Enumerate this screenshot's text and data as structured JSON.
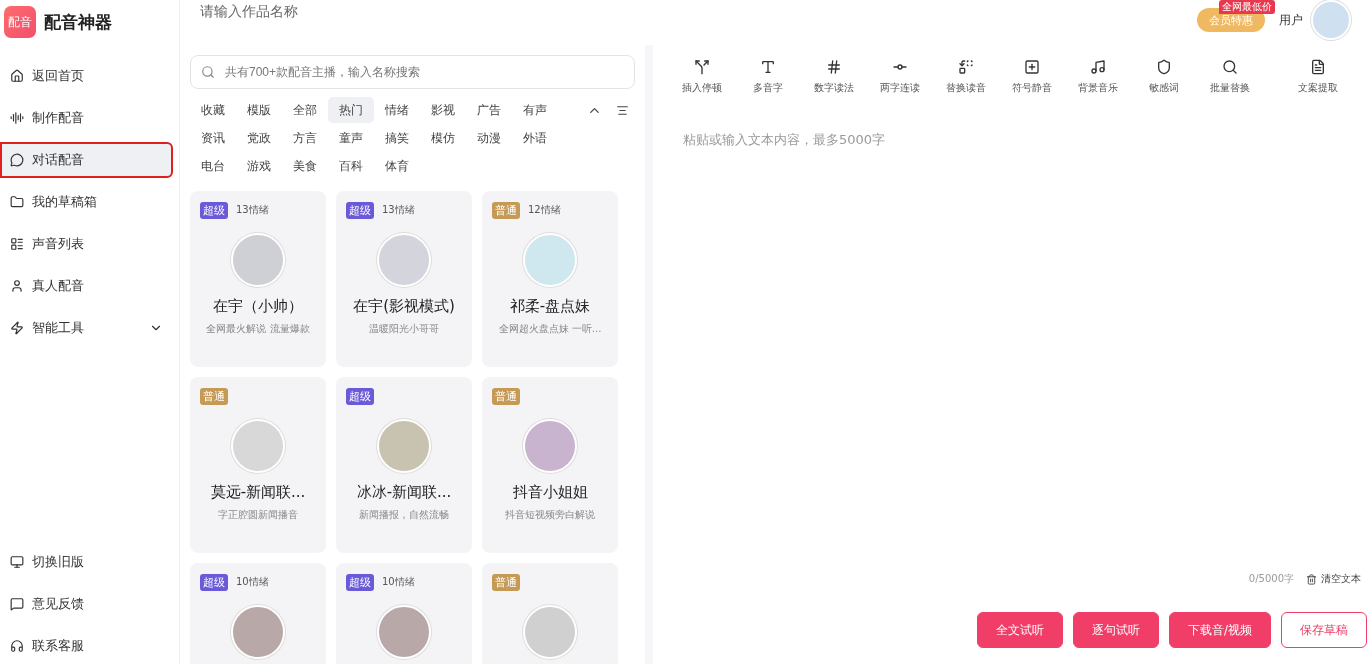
{
  "app": {
    "logo_text": "配音",
    "title": "配音神器"
  },
  "sidebar": {
    "items": [
      {
        "label": "返回首页",
        "selected": false
      },
      {
        "label": "制作配音",
        "selected": false
      },
      {
        "label": "对话配音",
        "selected": true
      },
      {
        "label": "我的草稿箱",
        "selected": false
      },
      {
        "label": "声音列表",
        "selected": false
      },
      {
        "label": "真人配音",
        "selected": false
      },
      {
        "label": "智能工具",
        "selected": false,
        "expanded": false
      }
    ],
    "bottom_items": [
      {
        "label": "切换旧版"
      },
      {
        "label": "意见反馈"
      },
      {
        "label": "联系客服"
      }
    ]
  },
  "header": {
    "title_placeholder": "请输入作品名称",
    "promo_button": "会员特惠",
    "promo_badge": "全网最低价",
    "user_name": "用户"
  },
  "voices": {
    "search_placeholder": "共有700+款配音主播，输入名称搜索",
    "categories": [
      {
        "label": "收藏",
        "selected": false
      },
      {
        "label": "模版",
        "selected": false
      },
      {
        "label": "全部",
        "selected": false
      },
      {
        "label": "热门",
        "selected": true
      },
      {
        "label": "情绪",
        "selected": false
      },
      {
        "label": "影视",
        "selected": false
      },
      {
        "label": "广告",
        "selected": false
      },
      {
        "label": "有声",
        "selected": false
      },
      {
        "label": "资讯",
        "selected": false
      },
      {
        "label": "党政",
        "selected": false
      },
      {
        "label": "方言",
        "selected": false
      },
      {
        "label": "童声",
        "selected": false
      },
      {
        "label": "搞笑",
        "selected": false
      },
      {
        "label": "模仿",
        "selected": false
      },
      {
        "label": "动漫",
        "selected": false
      },
      {
        "label": "外语",
        "selected": false
      },
      {
        "label": "电台",
        "selected": false
      },
      {
        "label": "游戏",
        "selected": false
      },
      {
        "label": "美食",
        "selected": false
      },
      {
        "label": "百科",
        "selected": false
      },
      {
        "label": "体育",
        "selected": false
      }
    ],
    "cards": [
      {
        "tier": "超级",
        "kind": "super",
        "emotions": "13情绪",
        "name": "在宇（小帅）",
        "desc": "全网最火解说 流量爆款"
      },
      {
        "tier": "超级",
        "kind": "super",
        "emotions": "13情绪",
        "name": "在宇(影视模式)",
        "desc": "温暖阳光小哥哥"
      },
      {
        "tier": "普通",
        "kind": "normal",
        "emotions": "12情绪",
        "name": "祁柔-盘点妹",
        "desc": "全网超火盘点妹 一听..."
      },
      {
        "tier": "普通",
        "kind": "normal",
        "name": "莫远-新闻联...",
        "desc": "字正腔圆新闻播音"
      },
      {
        "tier": "超级",
        "kind": "super",
        "name": "冰冰-新闻联...",
        "desc": "新闻播报，自然流畅"
      },
      {
        "tier": "普通",
        "kind": "normal",
        "name": "抖音小姐姐",
        "desc": "抖音短视频旁白解说"
      },
      {
        "tier": "超级",
        "kind": "super",
        "emotions": "10情绪"
      },
      {
        "tier": "超级",
        "kind": "super",
        "emotions": "10情绪"
      },
      {
        "tier": "普通",
        "kind": "normal"
      }
    ]
  },
  "editor": {
    "tools": [
      {
        "label": "插入停顿"
      },
      {
        "label": "多音字"
      },
      {
        "label": "数字读法"
      },
      {
        "label": "两字连读"
      },
      {
        "label": "替换读音"
      },
      {
        "label": "符号静音"
      },
      {
        "label": "背景音乐"
      },
      {
        "label": "敏感词"
      },
      {
        "label": "批量替换"
      },
      {
        "label": "文案提取"
      }
    ],
    "placeholder": "粘贴或输入文本内容，最多5000字",
    "count": "0/5000字",
    "clear": "清空文本",
    "buttons": [
      {
        "label": "全文试听",
        "kind": "primary"
      },
      {
        "label": "逐句试听",
        "kind": "primary"
      },
      {
        "label": "下载音/视频",
        "kind": "primary"
      },
      {
        "label": "保存草稿",
        "kind": "outline"
      }
    ]
  }
}
